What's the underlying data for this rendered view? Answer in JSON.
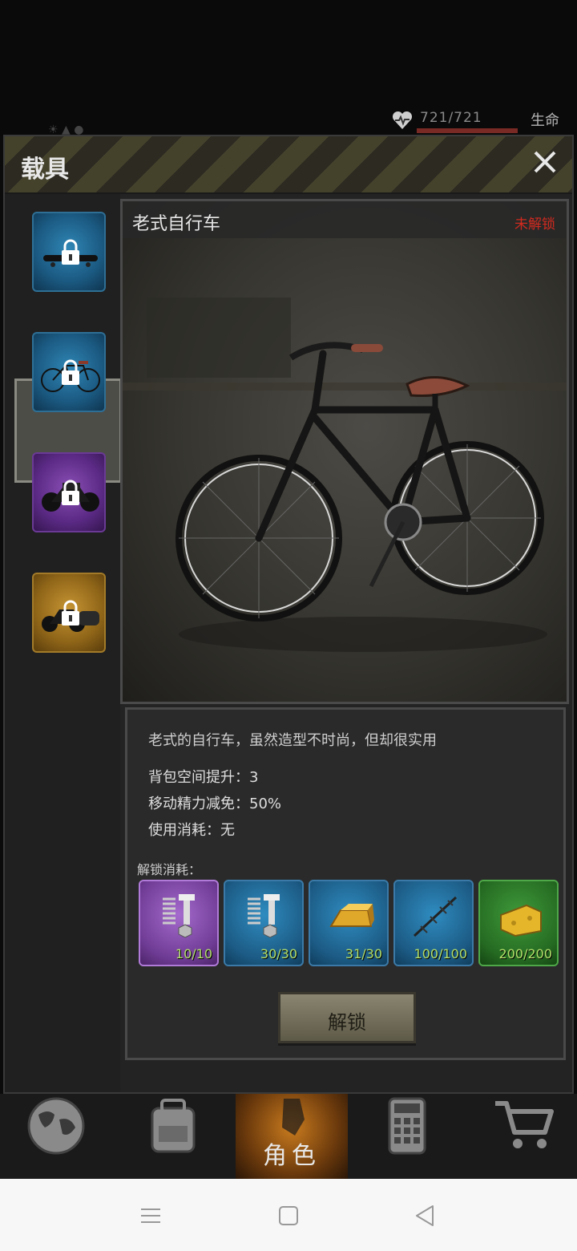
{
  "status": {
    "hp_value": "721/721",
    "hp_label": "生命",
    "hp_fraction": 1.0
  },
  "panel": {
    "title": "载具",
    "vehicles": [
      {
        "name": "skateboard",
        "rarity": "blue",
        "locked": true
      },
      {
        "name": "bicycle",
        "rarity": "blue",
        "locked": true,
        "selected": true
      },
      {
        "name": "motorcycle",
        "rarity": "purple",
        "locked": true
      },
      {
        "name": "sidecar-motorcycle",
        "rarity": "gold",
        "locked": true
      }
    ],
    "selected": {
      "name": "老式自行车",
      "status": "未解锁",
      "description": "老式的自行车，虽然造型不时尚，但却很实用",
      "stats": [
        "背包空间提升：3",
        "移动精力减免：50%",
        "使用消耗：无"
      ],
      "unlock_cost_label": "解锁消耗：",
      "materials": [
        {
          "icon": "spring-bolt-icon",
          "rarity": "purple",
          "count": "10/10"
        },
        {
          "icon": "spring-bolt-icon",
          "rarity": "blue",
          "count": "30/30"
        },
        {
          "icon": "gold-bar-icon",
          "rarity": "blue",
          "count": "31/30"
        },
        {
          "icon": "barbed-wire-icon",
          "rarity": "blue",
          "count": "100/100"
        },
        {
          "icon": "cheese-icon",
          "rarity": "green",
          "count": "200/200"
        }
      ],
      "unlock_button": "解锁"
    }
  },
  "nav": {
    "items": [
      "world-icon",
      "backpack-icon",
      "character-icon",
      "calculator-icon",
      "shop-cart-icon"
    ],
    "active_label": "角色"
  },
  "colors": {
    "locked_red": "#d12a1f",
    "count_green": "#b3e06a",
    "nav_active": "#c97b1e"
  }
}
